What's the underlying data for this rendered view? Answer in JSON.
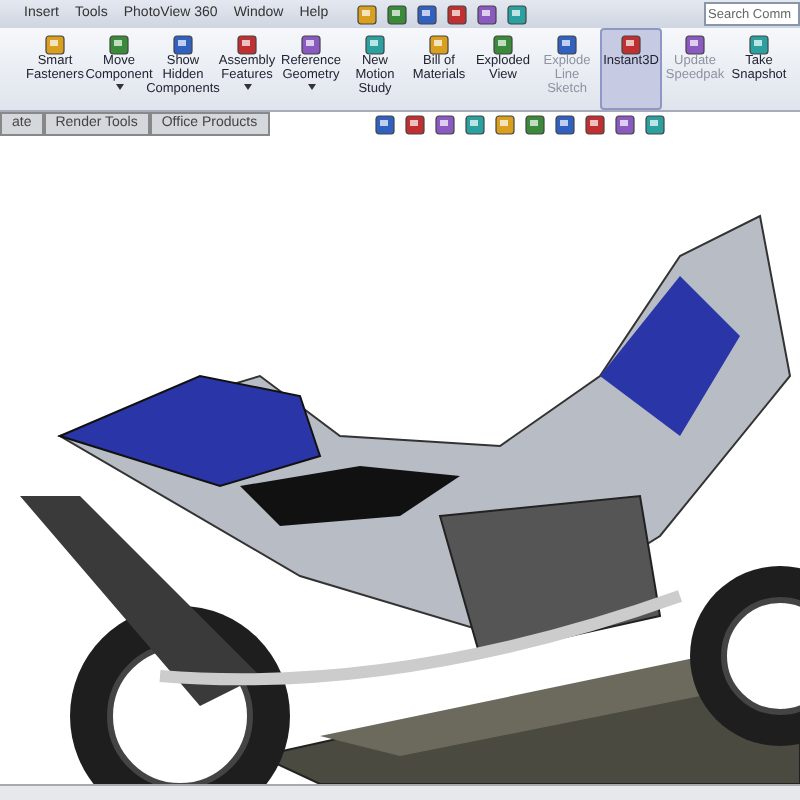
{
  "menu_bar": {
    "items": [
      "Insert",
      "Tools",
      "PhotoView 360",
      "Window",
      "Help"
    ],
    "search": {
      "placeholder": "Search Comm"
    }
  },
  "ribbon": {
    "buttons": [
      {
        "label": "Smart Fasteners",
        "dropdown": false,
        "disabled": false,
        "selected": false
      },
      {
        "label": "Move Component",
        "dropdown": true,
        "disabled": false,
        "selected": false
      },
      {
        "label": "Show Hidden Components",
        "dropdown": false,
        "disabled": false,
        "selected": false
      },
      {
        "label": "Assembly Features",
        "dropdown": true,
        "disabled": false,
        "selected": false
      },
      {
        "label": "Reference Geometry",
        "dropdown": true,
        "disabled": false,
        "selected": false
      },
      {
        "label": "New Motion Study",
        "dropdown": false,
        "disabled": false,
        "selected": false
      },
      {
        "label": "Bill of Materials",
        "dropdown": false,
        "disabled": false,
        "selected": false
      },
      {
        "label": "Exploded View",
        "dropdown": false,
        "disabled": false,
        "selected": false
      },
      {
        "label": "Explode Line Sketch",
        "dropdown": false,
        "disabled": true,
        "selected": false
      },
      {
        "label": "Instant3D",
        "dropdown": false,
        "disabled": false,
        "selected": true
      },
      {
        "label": "Update Speedpak",
        "dropdown": false,
        "disabled": true,
        "selected": false
      },
      {
        "label": "Take Snapshot",
        "dropdown": false,
        "disabled": false,
        "selected": false
      }
    ]
  },
  "tabs": [
    {
      "label": "ate",
      "selected": false
    },
    {
      "label": "Render Tools",
      "selected": false
    },
    {
      "label": "Office Products",
      "selected": false
    }
  ]
}
